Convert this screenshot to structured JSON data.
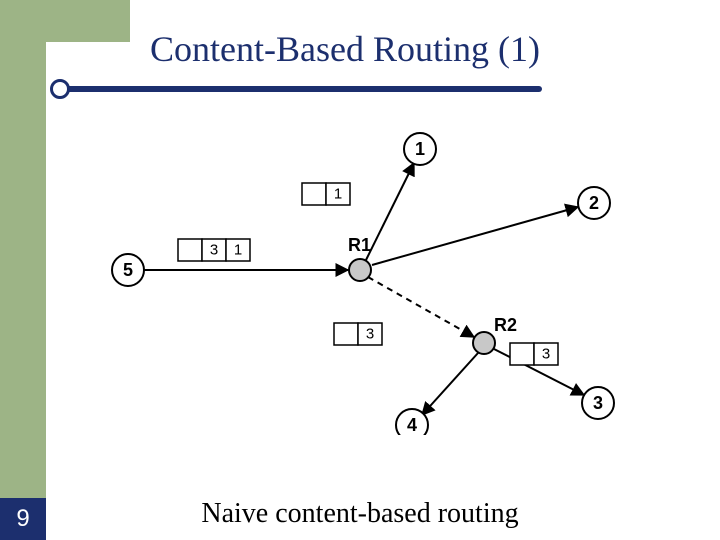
{
  "slide": {
    "title": "Content-Based Routing (1)",
    "caption": "Naive content-based routing",
    "page_number": "9"
  },
  "diagram": {
    "nodes": {
      "n1": "1",
      "n2": "2",
      "n3": "3",
      "n4": "4",
      "n5": "5"
    },
    "routers": {
      "r1": "R1",
      "r2": "R2"
    },
    "packets": {
      "p_near1": [
        "",
        "1"
      ],
      "p_from5": [
        "",
        "3",
        "1"
      ],
      "p_to_r2": [
        "",
        "3"
      ],
      "p_at_r2": [
        "",
        "3"
      ]
    }
  }
}
